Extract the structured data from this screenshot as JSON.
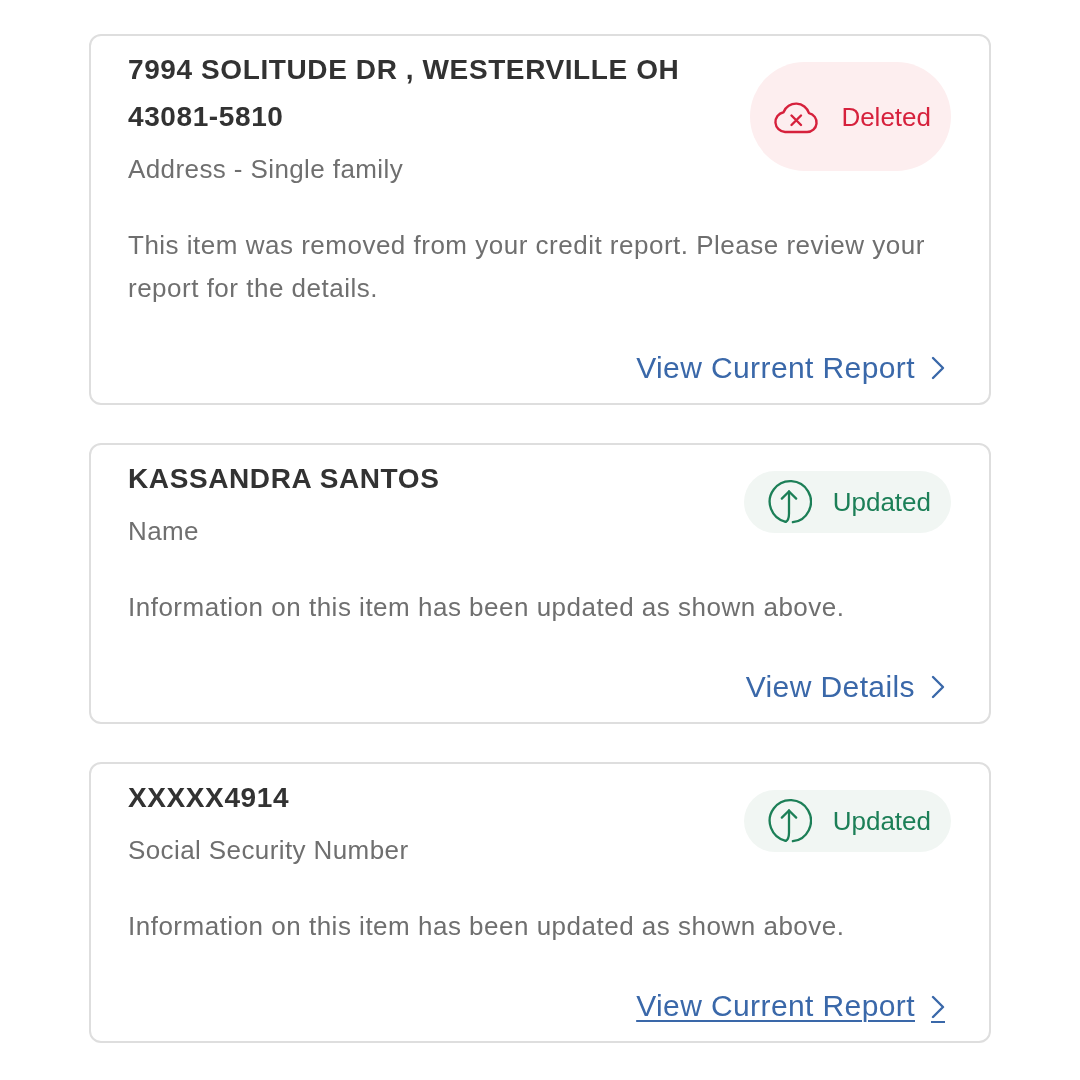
{
  "cards": [
    {
      "title": "7994 SOLITUDE DR , WESTERVILLE OH 43081-5810",
      "subtitle": "Address - Single family",
      "status": {
        "kind": "deleted",
        "label": "Deleted"
      },
      "description": "This item was removed from your credit report. Please review your report for the details.",
      "link": {
        "label": "View Current Report",
        "focused": false
      }
    },
    {
      "title": "KASSANDRA SANTOS",
      "subtitle": "Name",
      "status": {
        "kind": "updated",
        "label": "Updated"
      },
      "description": "Information on this item has been updated as shown above.",
      "link": {
        "label": "View Details",
        "focused": false
      }
    },
    {
      "title": "XXXXX4914",
      "subtitle": "Social Security Number",
      "status": {
        "kind": "updated",
        "label": "Updated"
      },
      "description": "Information on this item has been updated as shown above.",
      "link": {
        "label": "View Current Report",
        "focused": true
      }
    }
  ]
}
